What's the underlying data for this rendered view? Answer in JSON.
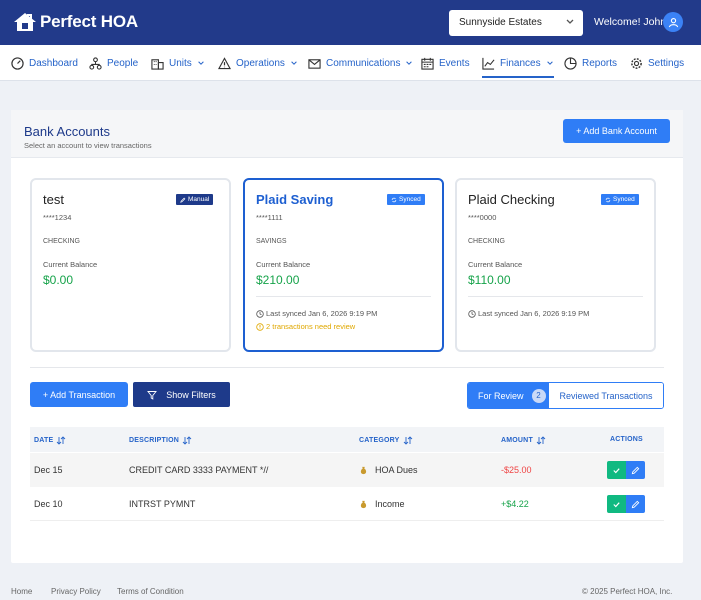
{
  "app": {
    "name": "Perfect HOA"
  },
  "header": {
    "community": "Sunnyside Estates",
    "welcome": "Welcome! John"
  },
  "nav": [
    {
      "label": "Dashboard",
      "icon": "dashboard-icon"
    },
    {
      "label": "People",
      "icon": "people-icon"
    },
    {
      "label": "Units",
      "icon": "building-icon"
    },
    {
      "label": "Operations",
      "icon": "warning-icon"
    },
    {
      "label": "Communications",
      "icon": "mail-icon"
    },
    {
      "label": "Events",
      "icon": "calendar-icon"
    },
    {
      "label": "Finances",
      "icon": "chart-icon",
      "active": true
    },
    {
      "label": "Reports",
      "icon": "reports-icon"
    },
    {
      "label": "Settings",
      "icon": "gear-icon"
    }
  ],
  "bank": {
    "title": "Bank Accounts",
    "subtitle": "Select an account to view transactions",
    "add_label": "+ Add Bank Account",
    "accounts": [
      {
        "name": "test",
        "badge": "Manual",
        "number": "****1234",
        "type": "CHECKING",
        "balance_label": "Current Balance",
        "balance": "$0.00"
      },
      {
        "name": "Plaid Saving",
        "badge": "Synced",
        "number": "****1111",
        "type": "SAVINGS",
        "balance_label": "Current Balance",
        "balance": "$210.00",
        "synced": "Last synced Jan 6, 2026 9:19 PM",
        "review": "2 transactions need review"
      },
      {
        "name": "Plaid Checking",
        "badge": "Synced",
        "number": "****0000",
        "type": "CHECKING",
        "balance_label": "Current Balance",
        "balance": "$110.00",
        "synced": "Last synced Jan 6, 2026 9:19 PM"
      }
    ]
  },
  "tx": {
    "add_label": "+ Add Transaction",
    "filters_label": "Show Filters",
    "tab_review": "For Review",
    "review_count": "2",
    "tab_reviewed": "Reviewed Transactions",
    "columns": {
      "date": "DATE",
      "description": "DESCRIPTION",
      "category": "CATEGORY",
      "amount": "AMOUNT",
      "actions": "ACTIONS"
    },
    "rows": [
      {
        "date": "Dec 15",
        "description": "CREDIT CARD 3333 PAYMENT *//",
        "category": "HOA Dues",
        "amount": "-$25.00"
      },
      {
        "date": "Dec 10",
        "description": "INTRST PYMNT",
        "category": "Income",
        "amount": "+$4.22"
      }
    ]
  },
  "footer": {
    "home": "Home",
    "privacy": "Privacy Policy",
    "terms": "Terms of Condition",
    "copyright": "© 2025 Perfect HOA, Inc."
  },
  "colors": {
    "header": "#223a8a",
    "primary": "#2f7df6",
    "positive": "#16a34a",
    "negative": "#ef4444",
    "warning": "#e0a800"
  }
}
